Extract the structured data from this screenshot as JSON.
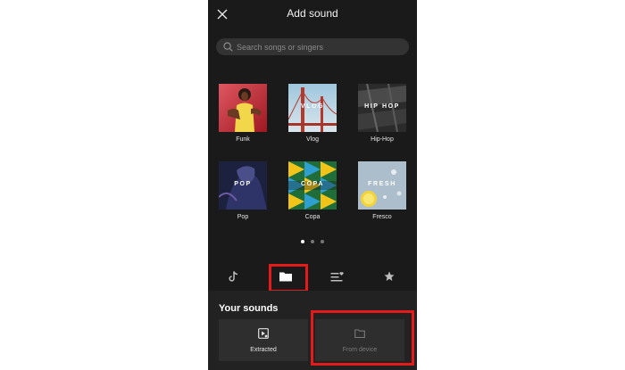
{
  "header": {
    "title": "Add sound",
    "close_icon": "close-icon"
  },
  "search": {
    "placeholder": "Search songs or singers",
    "icon": "search-icon"
  },
  "genres": [
    {
      "name": "Funk",
      "cover_text": ""
    },
    {
      "name": "Vlog",
      "cover_text": "VLOG"
    },
    {
      "name": "Hip-Hop",
      "cover_text": "HIP HOP"
    },
    {
      "name": "Pop",
      "cover_text": "POP"
    },
    {
      "name": "Copa",
      "cover_text": "COPA"
    },
    {
      "name": "Fresco",
      "cover_text": "FRESH"
    }
  ],
  "pagination": {
    "pages": 3,
    "current": 1
  },
  "tabs": [
    {
      "icon": "tiktok-icon",
      "selected": false
    },
    {
      "icon": "folder-icon",
      "selected": true
    },
    {
      "icon": "playlist-heart-icon",
      "selected": false
    },
    {
      "icon": "star-icon",
      "selected": false
    }
  ],
  "your_sounds": {
    "title": "Your sounds",
    "extracted_label": "Extracted",
    "from_device_label": "From device"
  },
  "colors": {
    "background": "#1a1a1a",
    "sheet": "#222222",
    "highlight": "#e31b1b"
  }
}
